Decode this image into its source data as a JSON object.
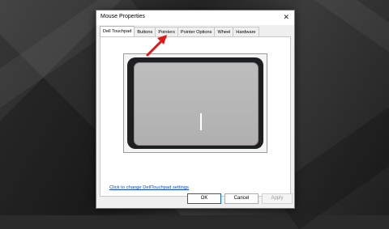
{
  "window": {
    "title": "Mouse Properties",
    "close_glyph": "✕"
  },
  "tabs": [
    {
      "label": "Dell Touchpad",
      "active": true
    },
    {
      "label": "Buttons"
    },
    {
      "label": "Pointers"
    },
    {
      "label": "Pointer Options"
    },
    {
      "label": "Wheel"
    },
    {
      "label": "Hardware"
    }
  ],
  "content": {
    "settings_link": "Click to change DellTouchpad settings"
  },
  "buttons": {
    "ok": "OK",
    "cancel": "Cancel",
    "apply": "Apply"
  },
  "colors": {
    "annotation_arrow": "#e01818",
    "link": "#0a45d3",
    "accent": "#0b63d6"
  },
  "icons": {
    "close": "close-icon",
    "annotation": "red-arrow-icon"
  }
}
